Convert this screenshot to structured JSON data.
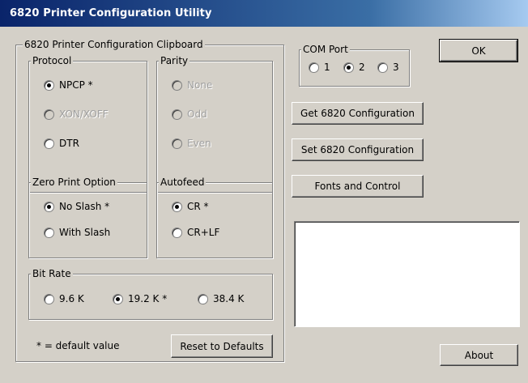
{
  "window": {
    "title": "6820 Printer Configuration Utility"
  },
  "clipboard": {
    "title": "6820 Printer Configuration Clipboard",
    "protocol": {
      "title": "Protocol",
      "options": [
        {
          "label": "NPCP *",
          "checked": true,
          "disabled": false
        },
        {
          "label": "XON/XOFF",
          "checked": false,
          "disabled": true
        },
        {
          "label": "DTR",
          "checked": false,
          "disabled": false
        }
      ]
    },
    "parity": {
      "title": "Parity",
      "options": [
        {
          "label": "None",
          "checked": false,
          "disabled": true
        },
        {
          "label": "Odd",
          "checked": false,
          "disabled": true
        },
        {
          "label": "Even",
          "checked": false,
          "disabled": true
        }
      ]
    },
    "zero_print": {
      "title": "Zero Print Option",
      "options": [
        {
          "label": "No Slash *",
          "checked": true,
          "disabled": false
        },
        {
          "label": "With Slash",
          "checked": false,
          "disabled": false
        }
      ]
    },
    "autofeed": {
      "title": "Autofeed",
      "options": [
        {
          "label": "CR *",
          "checked": true,
          "disabled": false
        },
        {
          "label": "CR+LF",
          "checked": false,
          "disabled": false
        }
      ]
    },
    "bit_rate": {
      "title": "Bit Rate",
      "options": [
        {
          "label": "9.6 K",
          "checked": false,
          "disabled": false
        },
        {
          "label": "19.2 K *",
          "checked": true,
          "disabled": false
        },
        {
          "label": "38.4 K",
          "checked": false,
          "disabled": false
        }
      ]
    },
    "default_note": "* = default value",
    "reset_label": "Reset to Defaults"
  },
  "com_port": {
    "title": "COM Port",
    "options": [
      {
        "label": "1",
        "checked": false
      },
      {
        "label": "2",
        "checked": true
      },
      {
        "label": "3",
        "checked": false
      }
    ]
  },
  "buttons": {
    "ok": "OK",
    "get_config": "Get 6820 Configuration",
    "set_config": "Set 6820 Configuration",
    "fonts": "Fonts and Control",
    "about": "About"
  }
}
